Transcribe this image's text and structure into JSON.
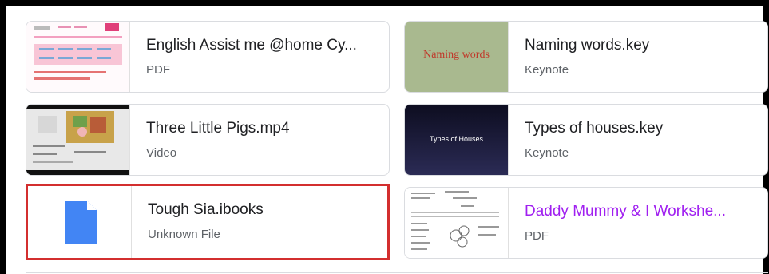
{
  "files": [
    {
      "title": "English Assist me @home Cy...",
      "type": "PDF"
    },
    {
      "title": "Naming words.key",
      "type": "Keynote",
      "thumb_text": "Naming words"
    },
    {
      "title": "Three Little Pigs.mp4",
      "type": "Video"
    },
    {
      "title": "Types of houses.key",
      "type": "Keynote",
      "thumb_text": "Types of Houses"
    },
    {
      "title": "Tough Sia.ibooks",
      "type": "Unknown File",
      "selected": true
    },
    {
      "title": "Daddy Mummy & I Workshe...",
      "type": "PDF",
      "title_color": "#a020f0"
    }
  ],
  "colors": {
    "selection_border": "#d32f2f",
    "generic_file_icon": "#4285f4",
    "naming_words_bg": "#a9b98f",
    "naming_words_text": "#c0392b",
    "types_houses_bg": "#1c1c3a"
  },
  "icons": {
    "generic_file": "file-icon"
  }
}
